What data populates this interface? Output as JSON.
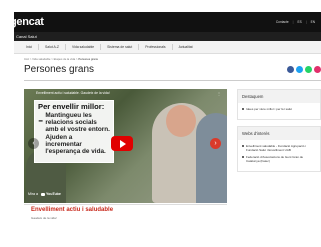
{
  "header": {
    "logo": "gencat",
    "links": [
      "Contacte",
      "ES",
      "EN"
    ],
    "site_name": "Canal Salut"
  },
  "nav": {
    "items": [
      "Inici",
      "Salut A-Z",
      "Vida saludable",
      "Sistema de salut",
      "Professionals",
      "Actualitat"
    ]
  },
  "breadcrumb": {
    "items": [
      "Inici",
      "Vida saludable",
      "Etapes de la vida"
    ],
    "current": "Persones grans"
  },
  "page_title": "Persones grans",
  "share_colors": [
    "#3b5998",
    "#1da1f2",
    "#25d366",
    "#e1306c"
  ],
  "video": {
    "top_title": "Envelliment actiu i saludable. Gaudeix de la vida!",
    "card_heading": "Per envellir millor:",
    "card_text": "Mantingueu les relacions socials amb el vostre entorn. Ajuden a incrementar l'esperança de vida.",
    "watch_on": "Mira a",
    "platform": "YouTube",
    "prev_icon": "chevron-left",
    "next_icon": "chevron-right"
  },
  "article": {
    "title": "Envelliment actiu i saludable",
    "subtitle": "Gaudeix de la vida!"
  },
  "sidebar": {
    "featured": {
      "heading": "Destaquem",
      "items": [
        "Idees per viure millor i per fer salut"
      ]
    },
    "links": {
      "heading": "Webs d'interès",
      "items": [
        "Envelliment saludable - Fundació Agrupació i Fundació Salut i Envelliment UAB",
        "Federació d'Associacions de Gent Gran de Catalunya (Fatec)"
      ]
    }
  }
}
